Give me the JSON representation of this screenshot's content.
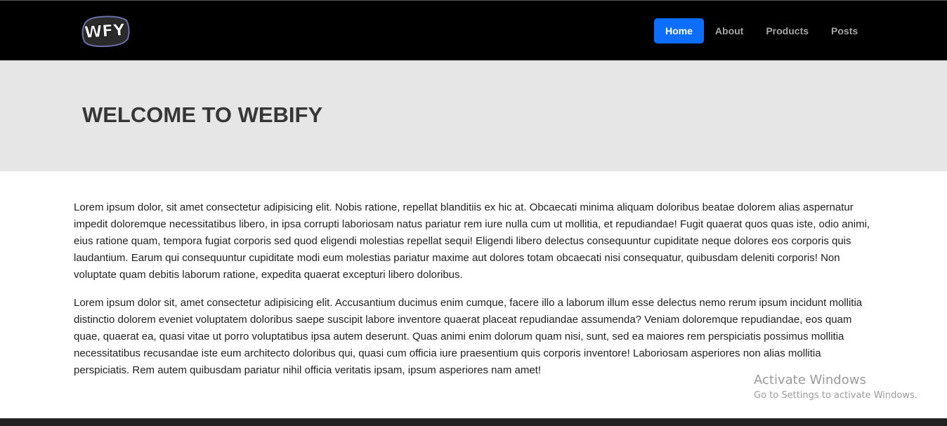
{
  "navbar": {
    "logo_text": "WFY",
    "links": [
      {
        "label": "Home",
        "active": true
      },
      {
        "label": "About",
        "active": false
      },
      {
        "label": "Products",
        "active": false
      },
      {
        "label": "Posts",
        "active": false
      }
    ]
  },
  "hero": {
    "title": "WELCOME TO WEBIFY"
  },
  "content": {
    "paragraphs": [
      "Lorem ipsum dolor, sit amet consectetur adipisicing elit. Nobis ratione, repellat blanditiis ex hic at. Obcaecati minima aliquam doloribus beatae dolorem alias aspernatur impedit doloremque necessitatibus libero, in ipsa corrupti laboriosam natus pariatur rem iure nulla cum ut mollitia, et repudiandae! Fugit quaerat quos quas iste, odio animi, eius ratione quam, tempora fugiat corporis sed quod eligendi molestias repellat sequi! Eligendi libero delectus consequuntur cupiditate neque dolores eos corporis quis laudantium. Earum qui consequuntur cupiditate modi eum molestias pariatur maxime aut dolores totam obcaecati nisi consequatur, quibusdam deleniti corporis! Non voluptate quam debitis laborum ratione, expedita quaerat excepturi libero doloribus.",
      "Lorem ipsum dolor sit, amet consectetur adipisicing elit. Accusantium ducimus enim cumque, facere illo a laborum illum esse delectus nemo rerum ipsum incidunt mollitia distinctio dolorem eveniet voluptatem doloribus saepe suscipit labore inventore quaerat placeat repudiandae assumenda? Veniam doloremque repudiandae, eos quam quae, quaerat ea, quasi vitae ut porro voluptatibus ipsa autem deserunt. Quas animi enim dolorum quam nisi, sunt, sed ea maiores rem perspiciatis possimus mollitia necessitatibus recusandae iste eum architecto doloribus qui, quasi cum officia iure praesentium quis corporis inventore! Laboriosam asperiores non alias mollitia perspiciatis. Rem autem quibusdam pariatur nihil officia veritatis ipsam, ipsum asperiores nam amet!"
    ]
  },
  "watermark": {
    "title": "Activate Windows",
    "subtitle": "Go to Settings to activate Windows."
  },
  "colors": {
    "navbar_bg": "#000000",
    "active_link_bg": "#0d6efd",
    "hero_bg": "#e6e6e6",
    "footer_bg": "#222222"
  }
}
